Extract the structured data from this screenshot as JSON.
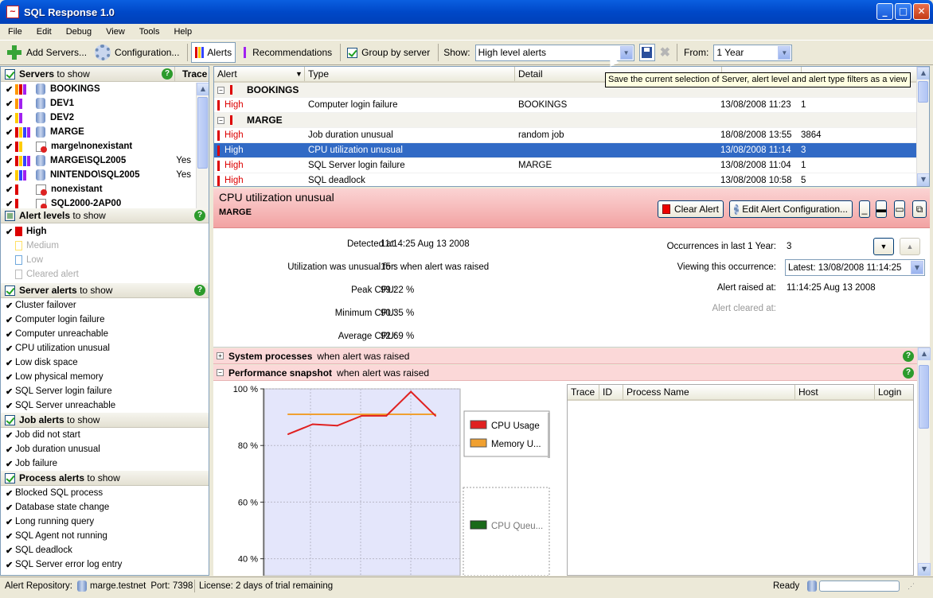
{
  "window": {
    "title": "SQL Response 1.0"
  },
  "menu": [
    "File",
    "Edit",
    "Debug",
    "View",
    "Tools",
    "Help"
  ],
  "toolbar": {
    "add_servers": "Add Servers...",
    "configuration": "Configuration...",
    "alerts": "Alerts",
    "recommendations": "Recommendations",
    "group_by_server": "Group by server",
    "show_label": "Show:",
    "show_value": "High level alerts",
    "from_label": "From:",
    "from_value": "1  Year"
  },
  "tooltip": "Save the current selection of Server, alert level and alert type filters as a view",
  "servers": {
    "header": "Servers",
    "header_suffix": "to show",
    "trace_label": "Trace",
    "items": [
      {
        "name": "BOOKINGS",
        "trace": "",
        "colors": [
          "#ff9900",
          "#dd0000",
          "#a020f0"
        ],
        "icon": "db-error"
      },
      {
        "name": "DEV1",
        "trace": "",
        "colors": [
          "#ff9900",
          "#a020f0"
        ],
        "icon": "db"
      },
      {
        "name": "DEV2",
        "trace": "",
        "colors": [
          "#ffcc00",
          "#a020f0"
        ],
        "icon": "db"
      },
      {
        "name": "MARGE",
        "trace": "",
        "colors": [
          "#dd0000",
          "#ffcc00",
          "#3344ff",
          "#a020f0"
        ],
        "icon": "db"
      },
      {
        "name": "marge\\nonexistant",
        "trace": "",
        "colors": [
          "#dd0000",
          "#ffcc00"
        ],
        "icon": "error"
      },
      {
        "name": "MARGE\\SQL2005",
        "trace": "Yes",
        "colors": [
          "#dd0000",
          "#ffcc00",
          "#3344ff",
          "#a020f0"
        ],
        "icon": "db"
      },
      {
        "name": "NINTENDO\\SQL2005",
        "trace": "Yes",
        "colors": [
          "#ffcc00",
          "#3344ff",
          "#a020f0"
        ],
        "icon": "db"
      },
      {
        "name": "nonexistant",
        "trace": "",
        "colors": [
          "#dd0000"
        ],
        "icon": "error"
      },
      {
        "name": "SQL2000-2AP00",
        "trace": "",
        "colors": [
          "#dd0000"
        ],
        "icon": "error"
      }
    ]
  },
  "alert_levels": {
    "header": "Alert levels",
    "header_suffix": "to show",
    "items": [
      {
        "label": "High",
        "checked": true,
        "color": "#dd0000"
      },
      {
        "label": "Medium",
        "checked": false,
        "color": "#ffe066"
      },
      {
        "label": "Low",
        "checked": false,
        "color": "#6fa8dc"
      },
      {
        "label": "Cleared alert",
        "checked": false,
        "color": "#bbbbbb"
      }
    ]
  },
  "server_alerts": {
    "header": "Server alerts",
    "header_suffix": "to show",
    "items": [
      "Cluster failover",
      "Computer login failure",
      "Computer unreachable",
      "CPU utilization unusual",
      "Low disk space",
      "Low physical memory",
      "SQL Server login failure",
      "SQL Server unreachable"
    ]
  },
  "job_alerts": {
    "header": "Job alerts",
    "header_suffix": "to show",
    "items": [
      "Job did not start",
      "Job duration unusual",
      "Job failure"
    ]
  },
  "process_alerts": {
    "header": "Process alerts",
    "header_suffix": "to show",
    "items": [
      "Blocked SQL process",
      "Database state change",
      "Long running query",
      "SQL Agent not running",
      "SQL deadlock",
      "SQL Server error log entry"
    ]
  },
  "alerts_grid": {
    "columns": [
      "Alert",
      "Type",
      "Detail"
    ],
    "groups": [
      {
        "name": "BOOKINGS",
        "rows": [
          {
            "level": "High",
            "type": "Computer login failure",
            "detail": "BOOKINGS",
            "time": "13/08/2008 11:23",
            "count": "1",
            "selected": false
          }
        ]
      },
      {
        "name": "MARGE",
        "rows": [
          {
            "level": "High",
            "type": "Job duration unusual",
            "detail": "random job",
            "time": "18/08/2008 13:55",
            "count": "3864",
            "selected": false
          },
          {
            "level": "High",
            "type": "CPU utilization unusual",
            "detail": "",
            "time": "13/08/2008 11:14",
            "count": "3",
            "selected": true
          },
          {
            "level": "High",
            "type": "SQL Server login failure",
            "detail": "MARGE",
            "time": "13/08/2008 11:04",
            "count": "1",
            "selected": false
          },
          {
            "level": "High",
            "type": "SQL deadlock",
            "detail": "",
            "time": "13/08/2008 10:58",
            "count": "5",
            "selected": false
          }
        ]
      }
    ]
  },
  "detail": {
    "title": "CPU utilization unusual",
    "server": "MARGE",
    "clear_alert": "Clear Alert",
    "edit_config": "Edit Alert Configuration...",
    "detected_label": "Detected at:",
    "detected_value": "11:14:25 Aug 13 2008",
    "unusual_label": "Utilization was unusual for:",
    "unusual_value": "15 s when alert was raised",
    "peak_label": "Peak CPU:",
    "peak_value": "99.22 %",
    "min_label": "Minimum CPU:",
    "min_value": "90.35 %",
    "avg_label": "Average CPU:",
    "avg_value": "92.69 %",
    "occ_label": "Occurrences in last 1  Year:",
    "occ_value": "3",
    "viewing_label": "Viewing this occurrence:",
    "viewing_value": "Latest: 13/08/2008 11:14:25",
    "raised_label": "Alert raised at:",
    "raised_value": "11:14:25 Aug 13 2008",
    "cleared_label": "Alert cleared at:"
  },
  "sections": {
    "system_processes": "System processes",
    "system_suffix": "when alert was raised",
    "perf_snapshot": "Performance snapshot",
    "perf_suffix": "when alert was raised"
  },
  "process_table": {
    "columns": [
      "Trace",
      "ID",
      "Process Name",
      "Host",
      "Login"
    ]
  },
  "chart_data": {
    "type": "line",
    "yticks": [
      "100 %",
      "80 %",
      "60 %",
      "40 %"
    ],
    "ylim": [
      34,
      100
    ],
    "x": [
      1,
      2,
      3,
      4,
      5,
      6,
      7
    ],
    "series": [
      {
        "name": "CPU Usage",
        "color": "#e02020",
        "values": [
          84,
          87.5,
          87,
          90.5,
          90.5,
          99,
          90.5
        ]
      },
      {
        "name": "Memory U...",
        "color": "#f0a030",
        "values": [
          91,
          91,
          91,
          91,
          91,
          91,
          91
        ]
      }
    ],
    "extra_legend": [
      {
        "name": "CPU Queu...",
        "color": "#1a6a1a"
      }
    ]
  },
  "status": {
    "repo_label": "Alert Repository:",
    "repo_value": "marge.testnet",
    "port": "Port: 7398",
    "license": "License: 2 days of trial remaining",
    "ready": "Ready"
  }
}
